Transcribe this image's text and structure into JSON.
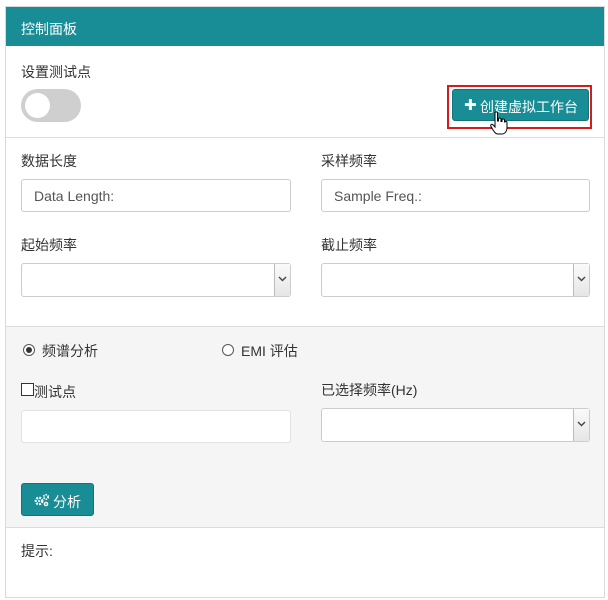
{
  "panel": {
    "title": "控制面板"
  },
  "test_point_setting": {
    "label": "设置测试点",
    "toggle_on": false
  },
  "create_button": {
    "icon": "plus-icon",
    "label": "创建虚拟工作台"
  },
  "fields": {
    "data_length": {
      "label": "数据长度",
      "placeholder": "Data Length:"
    },
    "sample_freq": {
      "label": "采样频率",
      "placeholder": "Sample Freq.:"
    },
    "start_freq": {
      "label": "起始频率",
      "value": ""
    },
    "stop_freq": {
      "label": "截止频率",
      "value": ""
    }
  },
  "analysis_mode": {
    "options": [
      {
        "label": "频谱分析",
        "checked": true
      },
      {
        "label": "EMI 评估",
        "checked": false
      }
    ]
  },
  "test_point": {
    "label": "测试点",
    "checked": false,
    "value": ""
  },
  "selected_freq": {
    "label": "已选择频率(Hz)",
    "value": ""
  },
  "analyze_button": {
    "icon": "gears-icon",
    "label": "分析"
  },
  "hint": {
    "label": "提示:"
  },
  "colors": {
    "accent": "#198d95",
    "highlight_border": "#d81a1a"
  }
}
